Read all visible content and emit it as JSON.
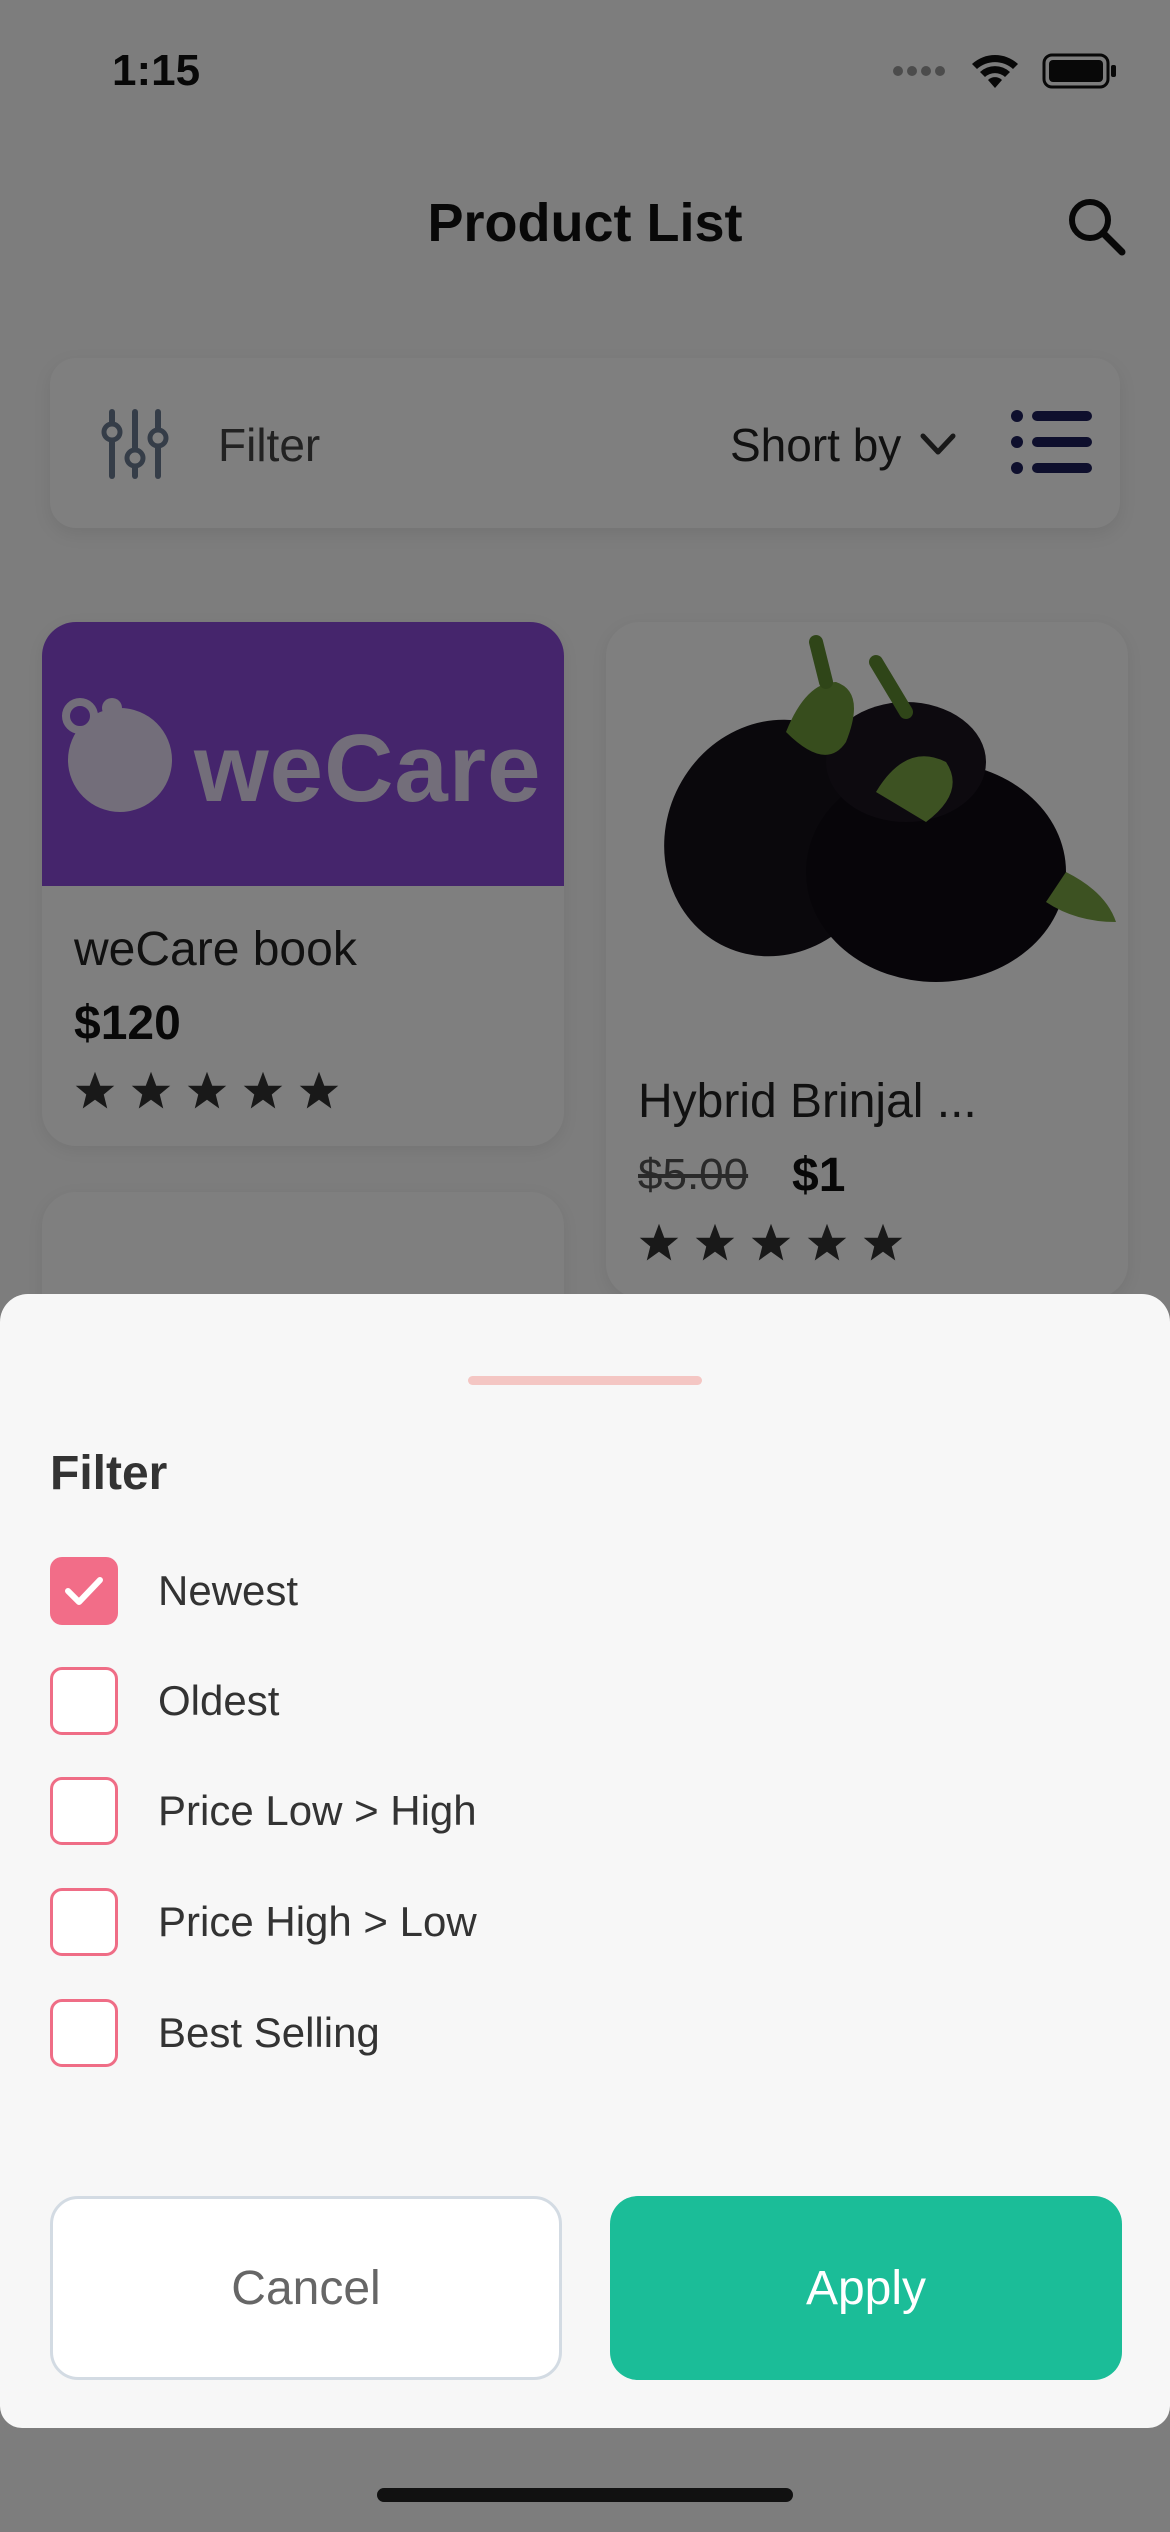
{
  "status_bar": {
    "time": "1:15"
  },
  "header": {
    "title": "Product List",
    "search_icon": "search-icon"
  },
  "filter_bar": {
    "filter_label": "Filter",
    "sort_label": "Short by",
    "filter_icon": "sliders-icon",
    "view_icon": "list-view-icon"
  },
  "products": [
    {
      "image_text": "weCare",
      "name": "weCare book",
      "price": "$120",
      "rating": 5
    },
    {
      "name": "Hybrid Brinjal ...",
      "old_price": "$5.00",
      "price": "$1",
      "rating": 5
    }
  ],
  "sheet": {
    "title": "Filter",
    "options": [
      {
        "label": "Newest",
        "checked": true
      },
      {
        "label": "Oldest",
        "checked": false
      },
      {
        "label": "Price Low > High",
        "checked": false
      },
      {
        "label": "Price High > Low",
        "checked": false
      },
      {
        "label": "Best Selling",
        "checked": false
      }
    ],
    "cancel_label": "Cancel",
    "apply_label": "Apply"
  },
  "colors": {
    "accent_pink": "#f26d88",
    "apply_green": "#1bbd98",
    "brand_purple": "#8a4bd8"
  }
}
